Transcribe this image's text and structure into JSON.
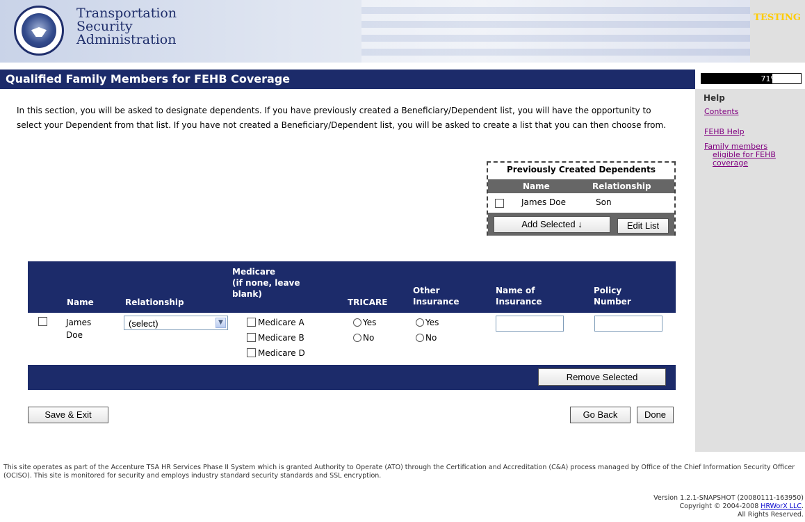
{
  "header": {
    "agency_lines": [
      "Transportation",
      "Security",
      "Administration"
    ],
    "environment_badge": "TESTING",
    "seal_text": "DEPARTMENT OF HOMELAND SECURITY"
  },
  "title": "Qualified Family Members for FEHB Coverage",
  "progress": {
    "label": "71%",
    "value": 0.71
  },
  "help": {
    "title": "Help",
    "links": [
      "Contents",
      "FEHB Help"
    ],
    "link3_lines": [
      "Family members",
      "eligible for FEHB",
      "coverage"
    ]
  },
  "intro": "In this section, you will be asked to designate dependents. If you have previously created a Beneficiary/Dependent list, you will have the opportunity to select your Dependent from that list. If you have not created a Beneficiary/Dependent list, you will be asked to create a list that you can then choose from.",
  "previous_dependents": {
    "title": "Previously Created Dependents",
    "columns": [
      "Name",
      "Relationship"
    ],
    "rows": [
      {
        "name": "James Doe",
        "relationship": "Son"
      }
    ],
    "add_selected_label": "Add Selected ↓",
    "edit_list_label": "Edit List"
  },
  "table": {
    "headers": {
      "name": "Name",
      "relationship": "Relationship",
      "medicare_lines": [
        "Medicare",
        "(if none, leave",
        "blank)"
      ],
      "tricare": "TRICARE",
      "other_lines": [
        "Other",
        "Insurance"
      ],
      "insurance_lines": [
        "Name of",
        "Insurance"
      ],
      "policy_lines": [
        "Policy",
        "Number"
      ]
    },
    "row": {
      "name_lines": [
        "James",
        "Doe"
      ],
      "relationship_value": "(select)",
      "medicare_options": [
        "Medicare A",
        "Medicare B",
        "Medicare D"
      ],
      "tricare_options": [
        "Yes",
        "No"
      ],
      "other_options": [
        "Yes",
        "No"
      ],
      "insurance_name": "",
      "policy_number": ""
    },
    "remove_selected_label": "Remove Selected"
  },
  "actions": {
    "save_exit": "Save & Exit",
    "go_back": "Go Back",
    "done": "Done"
  },
  "footer": {
    "text": "This site operates as part of the Accenture TSA HR Services Phase II System which is granted Authority to Operate (ATO) through the Certification and Accreditation (C&A) process managed by Office of the Chief Information Security Officer (OCISO). This site is monitored for security and employs industry standard security standards and SSL encryption.",
    "version": "Version 1.2.1-SNAPSHOT (20080111-163950)",
    "copyright_prefix": "Copyright © 2004-2008 ",
    "copyright_link": "HRWorX LLC",
    "copyright_suffix": ".",
    "rights": "All Rights Reserved."
  },
  "colors": {
    "navy": "#1c2b6a",
    "gray_panel": "#e0e0e0",
    "table_header_gray": "#666666",
    "testing_yellow": "#ffcc00",
    "visited_link": "#800080"
  }
}
